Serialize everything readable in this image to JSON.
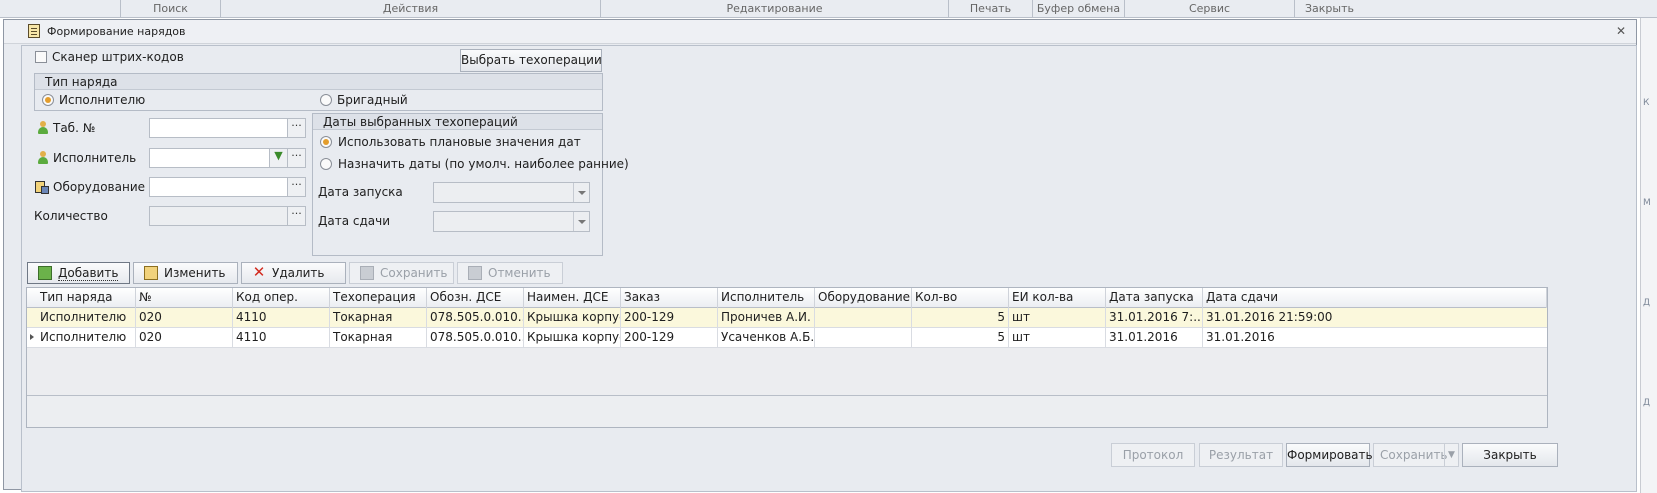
{
  "background": {
    "menu": [
      "Поиск",
      "Действия",
      "Редактирование",
      "Печать",
      "Буфер обмена",
      "Сервис",
      "Закрыть"
    ],
    "side_letters": [
      "К",
      "М",
      "Д",
      "Д"
    ]
  },
  "dialog": {
    "title": "Формирование нарядов",
    "barcode_scanner_label": "Сканер штрих-кодов",
    "select_ops_button": "Выбрать техоперации",
    "order_type": {
      "title": "Тип наряда",
      "option_executor": "Исполнителю",
      "option_brigade": "Бригадный",
      "selected": "Исполнителю"
    },
    "fields": {
      "tab_no_label": "Таб. №",
      "tab_no_value": "",
      "executor_label": "Исполнитель",
      "executor_value": "",
      "equipment_label": "Оборудование",
      "equipment_value": "",
      "quantity_label": "Количество",
      "quantity_value": ""
    },
    "dates_group": {
      "title": "Даты выбранных техопераций",
      "option_plan": "Использовать плановые значения дат",
      "option_assign": "Назначить даты (по умолч. наиболее ранние)",
      "selected": "Использовать плановые значения дат",
      "start_label": "Дата запуска",
      "start_value": "",
      "due_label": "Дата сдачи",
      "due_value": ""
    },
    "toolbar": {
      "add": "Добавить",
      "edit": "Изменить",
      "delete": "Удалить",
      "save": "Сохранить",
      "cancel": "Отменить"
    },
    "grid": {
      "columns": [
        "Тип наряда",
        "№",
        "Код опер.",
        "Техоперация",
        "Обозн. ДСЕ",
        "Наимен. ДСЕ",
        "Заказ",
        "Исполнитель",
        "Оборудование",
        "Кол-во",
        "ЕИ кол-ва",
        "Дата запуска",
        "Дата сдачи"
      ],
      "rows": [
        [
          "Исполнителю",
          "020",
          "4110",
          "Токарная",
          "078.505.0.010...",
          "Крышка корпуса",
          "200-129",
          "Проничев А.И.",
          "",
          "5",
          "шт",
          "31.01.2016 7:...",
          "31.01.2016 21:59:00"
        ],
        [
          "Исполнителю",
          "020",
          "4110",
          "Токарная",
          "078.505.0.010...",
          "Крышка корпуса",
          "200-129",
          "Усаченков А.Б.",
          "",
          "5",
          "шт",
          "31.01.2016",
          "31.01.2016"
        ]
      ]
    },
    "bottom": {
      "protocol": "Протокол",
      "result": "Результат",
      "form": "Формировать",
      "save": "Сохранить",
      "close": "Закрыть"
    }
  }
}
